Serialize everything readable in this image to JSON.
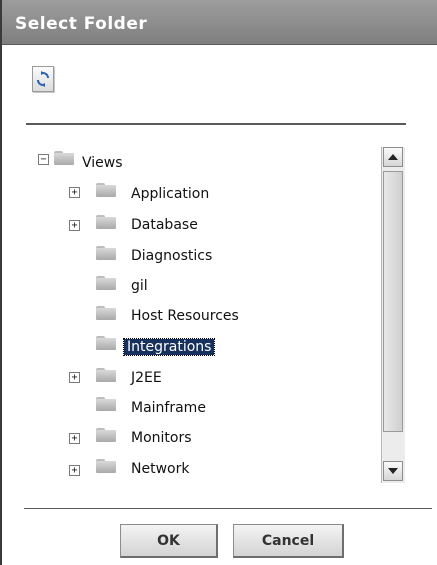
{
  "dialog": {
    "title": "Select Folder",
    "refresh_icon": "refresh-icon"
  },
  "tree": {
    "root": {
      "label": "Views",
      "expander": "−",
      "expanded": true
    },
    "items": [
      {
        "label": "Application",
        "expander": "+",
        "has_children": true
      },
      {
        "label": "Database",
        "expander": "+",
        "has_children": true
      },
      {
        "label": "Diagnostics",
        "has_children": false
      },
      {
        "label": "gil",
        "has_children": false
      },
      {
        "label": "Host Resources",
        "has_children": false
      },
      {
        "label": "Integrations",
        "has_children": false,
        "selected": true
      },
      {
        "label": "J2EE",
        "expander": "+",
        "has_children": true
      },
      {
        "label": "Mainframe",
        "has_children": false
      },
      {
        "label": "Monitors",
        "expander": "+",
        "has_children": true
      },
      {
        "label": "Network",
        "expander": "+",
        "has_children": true
      }
    ]
  },
  "buttons": {
    "ok_label": "OK",
    "cancel_label": "Cancel"
  },
  "colors": {
    "titlebar": "#8c8c8c",
    "selection": "#16315e"
  }
}
